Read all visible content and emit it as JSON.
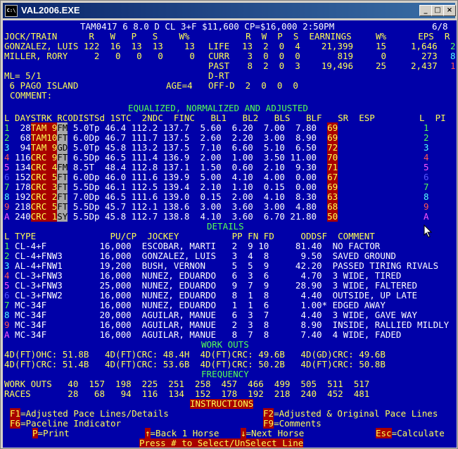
{
  "window": {
    "title": "VAL2006.EXE",
    "icon": "dos-app-icon",
    "buttons": [
      "_",
      "□",
      "×"
    ]
  },
  "header": {
    "race_line": "TAM0417 6 8.0 D CL 3+F $11,600 CP=$16,000 2:50PM",
    "page": "6/8"
  },
  "jock_header": {
    "left": "JOCK/TRAIN      R   W   P   S    W%",
    "mid": "    R  W  P  S  EARNINGS",
    "right": "W%      EPS  R"
  },
  "jock_rows": [
    {
      "name": "GONZALEZ, LUIS 122  16  13  13    13",
      "label": "LIFE",
      "stats": "13  2  0  4    21,399",
      "pct": "15",
      "eps": "1,646",
      "r": "2"
    },
    {
      "name": "MILLER, RORY     2   0   0   0     0",
      "label": "CURR",
      "stats": " 3  0  0  0       819",
      "pct": " 0",
      "eps": "  273",
      "r": "8"
    },
    {
      "name": "",
      "label": "PAST",
      "stats": " 8  2  0  3    19,496",
      "pct": "25",
      "eps": "2,437",
      "r": "1"
    }
  ],
  "ml": "ML= 5/1",
  "drt": "D-RT",
  "horse": {
    "text": " 6 PAGO ISLAND",
    "age": "AGE=4",
    "offd": "OFF-D  2  0  0  0"
  },
  "comment_label": "COMMENT:",
  "eq_title": "EQUALIZED, NORMALIZED AND ADJUSTED",
  "eq_header": {
    "left": "L DAYSTRK RCODISTSd 1STC  2NDC  FINC   BL1   BL2   BLS   BLF   SR  ESP",
    "right": "L  PI"
  },
  "eq_rows": [
    {
      "l": "1",
      "days": " 28",
      "trk": "TAM",
      "rc": " 9",
      "cod": "FM",
      "rest": "5.0Tp 46.4 112.2 137.7  5.60  6.20  7.00  7.80",
      "sr": "69",
      "r": "1",
      "lc": "c-g"
    },
    {
      "l": "2",
      "days": " 68",
      "trk": "TAM",
      "rc": "10",
      "cod": "FT",
      "rest": "6.0Dp 46.7 111.7 137.5  2.60  2.20  3.00  8.90",
      "sr": "69",
      "r": "2",
      "lc": "c-g"
    },
    {
      "l": "3",
      "days": " 94",
      "trk": "TAM",
      "rc": " 9",
      "cod": "GD",
      "rest": "5.0Tp 45.8 113.2 137.5  7.10  6.60  5.10  6.50",
      "sr": "72",
      "r": "3",
      "lc": "c-c"
    },
    {
      "l": "4",
      "days": "116",
      "trk": "CRC",
      "rc": " 9",
      "cod": "FT",
      "rest": "6.5Dp 46.5 111.4 136.9  2.00  1.00  3.50 11.00",
      "sr": "70",
      "r": "4",
      "lc": "c-r"
    },
    {
      "l": "5",
      "days": "134",
      "trk": "CRC",
      "rc": " 4",
      "cod": "FM",
      "rest": "8.5T  48.4 112.8 137.1  1.50  0.60  2.10  9.30",
      "sr": "71",
      "r": "5",
      "lc": "c-m"
    },
    {
      "l": "6",
      "days": "152",
      "trk": "CRC",
      "rc": " 5",
      "cod": "FT",
      "rest": "6.0Dp 46.0 111.6 139.9  5.00  4.10  4.00  0.00",
      "sr": "67",
      "r": "6",
      "lc": "c-b"
    },
    {
      "l": "7",
      "days": "178",
      "trk": "CRC",
      "rc": " 3",
      "cod": "FT",
      "rest": "5.5Dp 46.1 112.5 139.4  2.10  1.10  0.15  0.00",
      "sr": "69",
      "r": "7",
      "lc": "c-g"
    },
    {
      "l": "8",
      "days": "192",
      "trk": "CRC",
      "rc": " 2",
      "cod": "FT",
      "rest": "7.0Dp 46.5 111.6 139.0  0.15  2.00  4.10  8.30",
      "sr": "63",
      "r": "8",
      "lc": "c-c"
    },
    {
      "l": "9",
      "days": "218",
      "trk": "CRC",
      "rc": " 5",
      "cod": "FT",
      "rest": "5.5Dp 45.7 112.1 138.6  3.00  3.60  3.00  4.80",
      "sr": "68",
      "r": "9",
      "lc": "c-r"
    },
    {
      "l": "A",
      "days": "240",
      "trk": "CRC",
      "rc": " 1",
      "cod": "SY",
      "rest": "5.5Dp 45.8 112.7 138.8  4.10  3.60  6.70 21.80",
      "sr": "50",
      "r": "A",
      "lc": "c-m"
    }
  ],
  "details_title": "DETAILS",
  "details_header": "L TYPE              PU/CP  JOCKEY          PP FN FD     ODDSF  COMMENT",
  "details_rows": [
    {
      "l": "1",
      "lc": "c-g",
      "text": " CL-4+F          16,000  ESCOBAR, MARTI   2  9 10     81.40  NO FACTOR"
    },
    {
      "l": "2",
      "lc": "c-g",
      "text": " CL-4+FNW3       16,000  GONZALEZ, LUIS   3  4  8      9.50  SAVED GROUND"
    },
    {
      "l": "3",
      "lc": "c-c",
      "text": " AL-4+FNW1       19,200  BUSH, VERNON     5  5  9     42.20  PASSED TIRING RIVALS"
    },
    {
      "l": "4",
      "lc": "c-r",
      "text": " CL-3+FNW3       16,000  NUNEZ, EDUARDO   6  3  6      4.70  3 WIDE, TIRED"
    },
    {
      "l": "5",
      "lc": "c-m",
      "text": " CL-3+FNW3       25,000  NUNEZ, EDUARDO   9  7  9     28.90  3 WIDE, FALTERED"
    },
    {
      "l": "6",
      "lc": "c-b",
      "text": " CL-3+FNW2       16,000  NUNEZ, EDUARDO   8  1  8      4.40  OUTSIDE, UP LATE"
    },
    {
      "l": "7",
      "lc": "c-g",
      "text": " MC-34F          16,000  NUNEZ, EDUARDO   1  1  6      1.00* EDGED AWAY"
    },
    {
      "l": "8",
      "lc": "c-c",
      "text": " MC-34F          20,000  AGUILAR, MANUE   6  3  7      4.40  3 WIDE, GAVE WAY"
    },
    {
      "l": "9",
      "lc": "c-r",
      "text": " MC-34F          16,000  AGUILAR, MANUE   2  3  8      8.90  INSIDE, RALLIED MILDLY"
    },
    {
      "l": "A",
      "lc": "c-m",
      "text": " MC-34F          16,000  AGUILAR, MANUE   8  7  8      7.40  4 WIDE, FADED"
    }
  ],
  "workouts_title": "WORK OUTS",
  "workouts": [
    "4D(FT)OHC: 51.8B   4D(FT)CRC: 48.4H  4D(FT)CRC: 49.6B   4D(GD)CRC: 49.6B",
    "4D(FT)CRC: 51.4B   4D(FT)CRC: 53.6B  4D(FT)CRC: 50.2B   4D(FT)CRC: 50.8B"
  ],
  "frequency_title": "FREQUENCY",
  "frequency": [
    "WORK OUTS   40  157  198  225  251  258  457  466  499  505  511  517",
    "RACES       28   68   94  116  134  152  178  192  218  240  452  481"
  ],
  "instructions_title": "INSTRUCTIONS",
  "keys": {
    "f1": {
      "key": "F1",
      "text": "=Adjusted Pace Lines/Details"
    },
    "f2": {
      "key": "F2",
      "text": "=Adjusted & Original Pace Lines"
    },
    "f6": {
      "key": "F6",
      "text": "=Paceline Indicator"
    },
    "f9": {
      "key": "F9",
      "text": "=Comments"
    },
    "p": {
      "key": "P",
      "text": "=Print"
    },
    "up": {
      "key": "↑",
      "text": "=Back 1 Horse"
    },
    "down": {
      "key": "↓",
      "text": "=Next Horse"
    },
    "esc": {
      "key": "Esc",
      "text": "=Calculate"
    }
  },
  "footer": "Press # to Select/UnSelect Line"
}
